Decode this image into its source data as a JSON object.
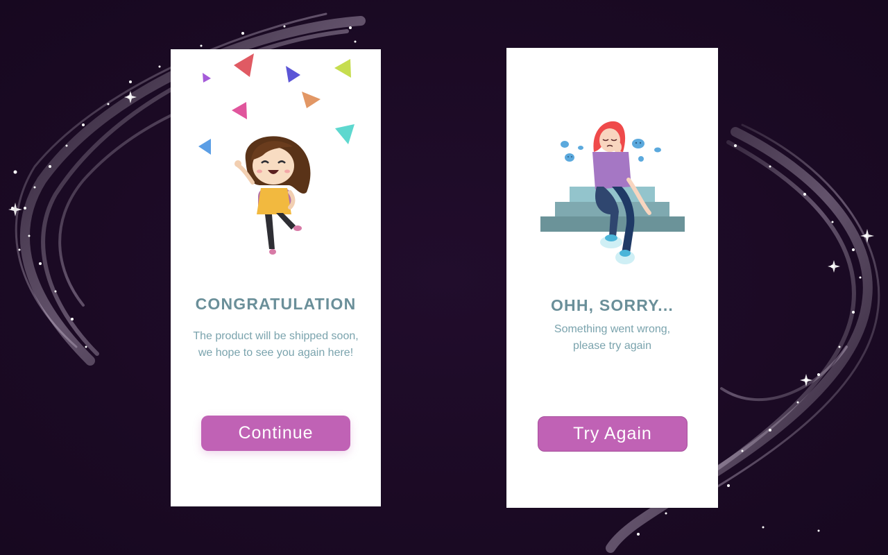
{
  "success_card": {
    "title": "CONGRATULATION",
    "message_line1": "The product will be shipped soon,",
    "message_line2": "we hope to see you again here!",
    "button_label": "Continue",
    "illustration": "celebrating-girl-with-confetti"
  },
  "error_card": {
    "title": "OHH, SORRY...",
    "message_line1": "Something went wrong,",
    "message_line2": "please try again",
    "button_label": "Try Again",
    "illustration": "sad-girl-on-stairs"
  },
  "colors": {
    "background": "#1b0a24",
    "card": "#ffffff",
    "title": "#6a8f99",
    "message": "#7aa3ad",
    "button": "#c062b5"
  }
}
